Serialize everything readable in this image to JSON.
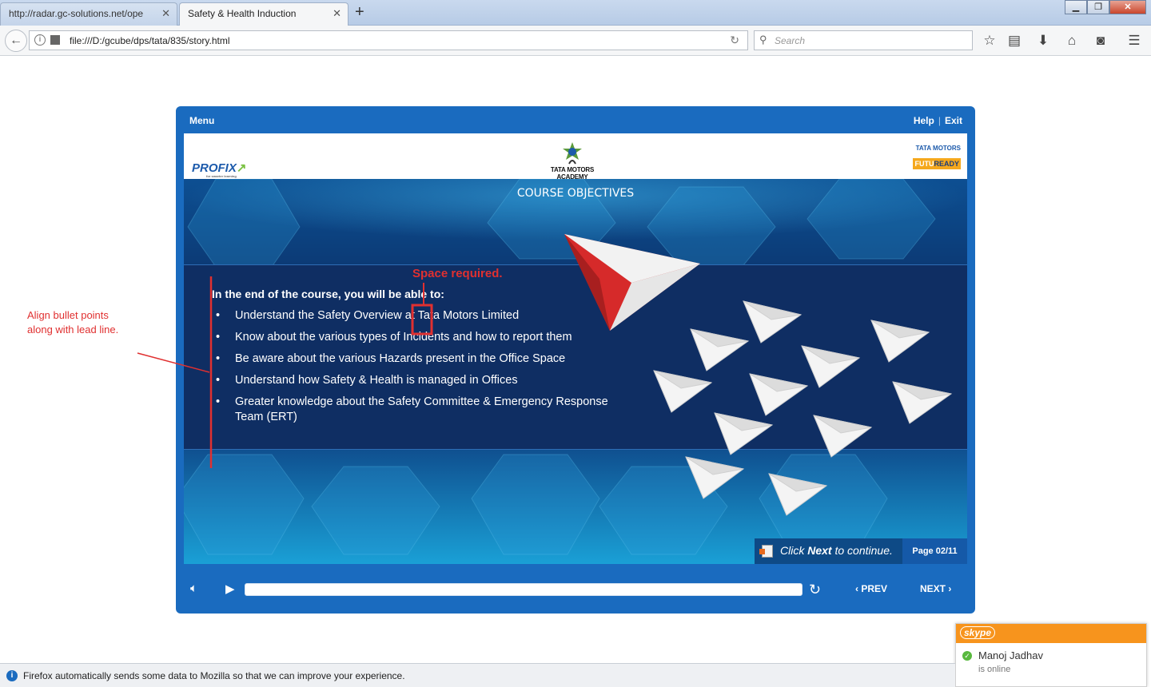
{
  "browser": {
    "tabs": [
      {
        "label": "http://radar.gc-solutions.net/ope",
        "active": false
      },
      {
        "label": "Safety & Health Induction",
        "active": true
      }
    ],
    "url": "file:///D:/gcube/dps/tata/835/story.html",
    "search_placeholder": "Search",
    "window_buttons": [
      "minimize",
      "maximize",
      "close"
    ],
    "toolbar_icons": [
      "bookmark-star-icon",
      "reading-list-icon",
      "download-icon",
      "home-icon",
      "pocket-icon",
      "hamburger-menu-icon"
    ]
  },
  "player": {
    "menu_label": "Menu",
    "help_label": "Help",
    "separator": "|",
    "exit_label": "Exit",
    "logos": {
      "profix": "PROFIX",
      "profix_tagline": "for smarter learning",
      "academy": "TATA MOTORS ACADEMY",
      "tata_motors": "TATA MOTORS",
      "futuready_prefix": "FUTU",
      "futuready_suffix": "READY"
    },
    "course_title": "COURSE OBJECTIVES",
    "lead_line": "In the end of the course, you will be able to:",
    "bullet_char": "•",
    "objectives": [
      "Understand the Safety Overview at Tata Motors Limited",
      "Know about the various types of Incidents and how to report them",
      "Be aware about the various Hazards present in the Office Space",
      "Understand how Safety & Health is managed in Offices",
      "Greater knowledge about the Safety Committee & Emergency Response Team (ERT)"
    ],
    "cta_prefix": "Click ",
    "cta_bold": "Next",
    "cta_suffix": " to continue.",
    "page_indicator": "Page 02/11",
    "controls": {
      "prev_label": "PREV",
      "next_label": "NEXT",
      "progress": 0.0
    }
  },
  "annotations": {
    "align_note_line1": "Align bullet points",
    "align_note_line2": "along with lead line.",
    "space_note": "Space required."
  },
  "skype": {
    "logo": "skype",
    "name": "Manoj Jadhav",
    "status": "is online"
  },
  "notification": {
    "text": "Firefox automatically sends some data to Mozilla so that we can improve your experience."
  },
  "colors": {
    "player_blue": "#1a6bbf",
    "annotation_red": "#e03030",
    "skype_orange": "#f7941d",
    "plane_red": "#d62a2a"
  }
}
